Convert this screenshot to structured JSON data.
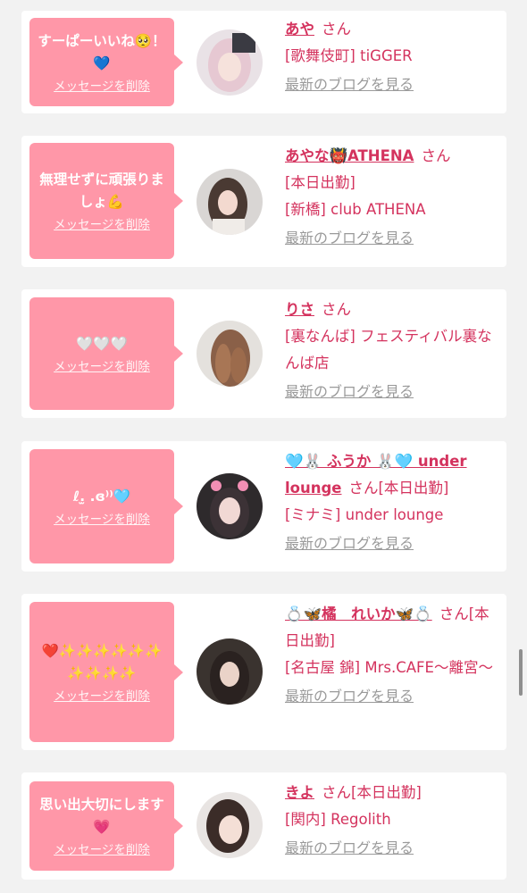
{
  "delete_label": "メッセージを削除",
  "blog_label": "最新のブログを見る",
  "colors": {
    "accent": "#d4335e",
    "bubble": "#ff97a8",
    "muted": "#9a9a9a"
  },
  "cards": [
    {
      "message": "すーぱーいいね🥺！💙",
      "name": "あや",
      "san": "さん",
      "status": "",
      "shop": "[歌舞伎町] tiGGER"
    },
    {
      "message": "無理せずに頑張りましょ💪",
      "name": "あやな👹ATHENA",
      "san": "さん",
      "status": "[本日出勤]",
      "shop": "[新橋] club ATHENA"
    },
    {
      "message": "🤍🤍🤍",
      "name": "りさ",
      "san": "さん",
      "status": "",
      "shop": "[裏なんば] フェスティバル裏なんば店"
    },
    {
      "message": "ℓ.̫ .ɞ⁾⁾🩵",
      "name": "🩵🐰 ふうか 🐰🩵 under lounge",
      "san": "さん",
      "status": "[本日出勤]",
      "shop": "[ミナミ] under lounge"
    },
    {
      "message": "❤️✨✨✨✨✨✨✨✨✨✨",
      "name": "💍🦋橘　れいか🦋💍",
      "san": "さん",
      "status": "[本日出勤]",
      "shop": "[名古屋 錦] Mrs.CAFE〜離宮〜"
    },
    {
      "message": "思い出大切にします💗",
      "name": "きよ",
      "san": "さん",
      "status": "[本日出勤]",
      "shop": "[関内] Regolith"
    }
  ]
}
